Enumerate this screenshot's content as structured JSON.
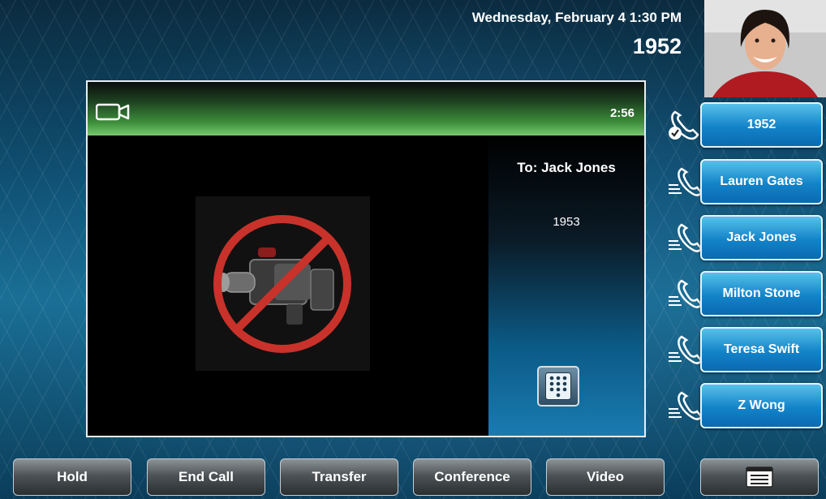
{
  "header": {
    "datetime": "Wednesday, February 4  1:30 PM",
    "extension": "1952"
  },
  "call": {
    "timer": "2:56",
    "to_label": "To: Jack Jones",
    "to_number": "1953"
  },
  "lines": [
    {
      "label": "1952",
      "icon": "phone-active-icon"
    },
    {
      "label": "Lauren Gates",
      "icon": "phone-line-icon"
    },
    {
      "label": "Jack Jones",
      "icon": "phone-line-icon"
    },
    {
      "label": "Milton Stone",
      "icon": "phone-line-icon"
    },
    {
      "label": "Teresa Swift",
      "icon": "phone-line-icon"
    },
    {
      "label": "Z Wong",
      "icon": "phone-line-icon"
    }
  ],
  "softkeys": [
    {
      "label": "Hold"
    },
    {
      "label": "End Call"
    },
    {
      "label": "Transfer"
    },
    {
      "label": "Conference"
    },
    {
      "label": "Video"
    }
  ],
  "colors": {
    "header_green": "#3c8d3a",
    "line_button_blue": "#1383c8",
    "no_video_red": "#c8322a"
  }
}
